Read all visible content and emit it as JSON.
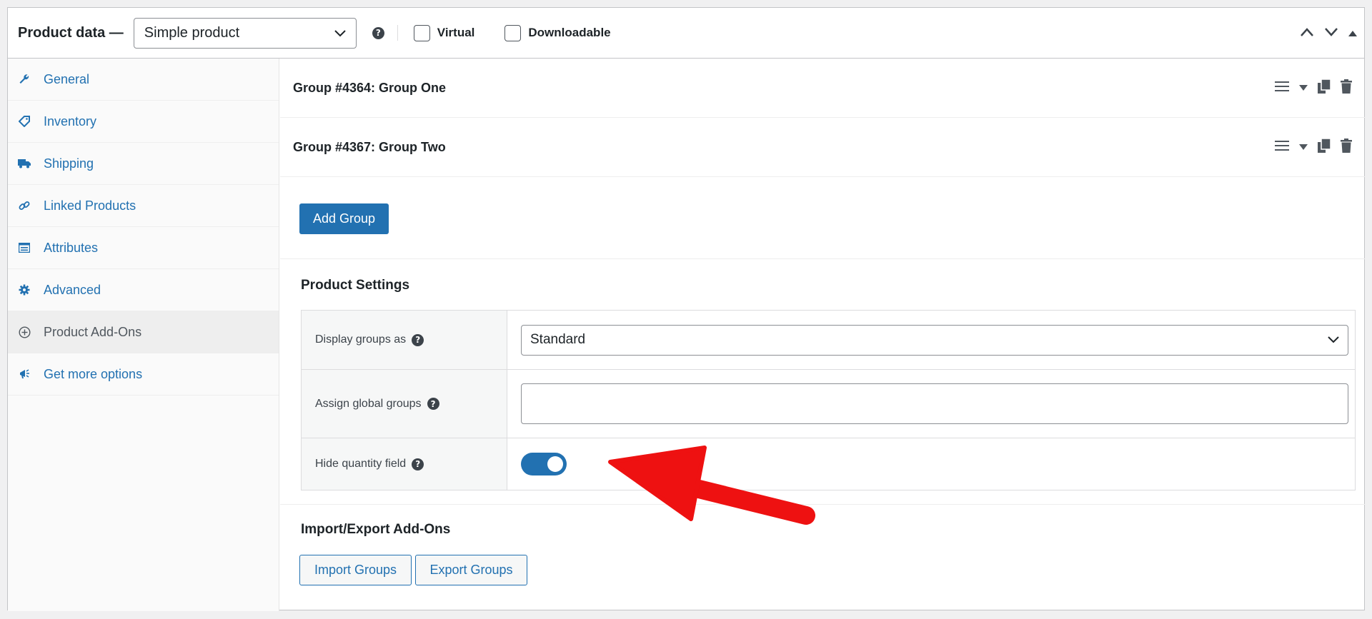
{
  "header": {
    "title": "Product data —",
    "product_type": "Simple product",
    "help": "?",
    "virtual_label": "Virtual",
    "downloadable_label": "Downloadable"
  },
  "sidebar": {
    "items": [
      {
        "label": "General",
        "icon": "wrench-icon"
      },
      {
        "label": "Inventory",
        "icon": "tag-icon"
      },
      {
        "label": "Shipping",
        "icon": "truck-icon"
      },
      {
        "label": "Linked Products",
        "icon": "link-icon"
      },
      {
        "label": "Attributes",
        "icon": "list-icon"
      },
      {
        "label": "Advanced",
        "icon": "gear-icon"
      },
      {
        "label": "Product Add-Ons",
        "icon": "plus-circle-icon"
      },
      {
        "label": "Get more options",
        "icon": "megaphone-icon"
      }
    ]
  },
  "groups": [
    {
      "title": "Group #4364: Group One"
    },
    {
      "title": "Group #4367: Group Two"
    }
  ],
  "add_group_label": "Add Group",
  "product_settings": {
    "title": "Product Settings",
    "display_groups_label": "Display groups as",
    "display_groups_value": "Standard",
    "assign_global_label": "Assign global groups",
    "hide_quantity_label": "Hide quantity field",
    "hide_quantity_on": true
  },
  "import_export": {
    "title": "Import/Export Add-Ons",
    "import_label": "Import Groups",
    "export_label": "Export Groups"
  },
  "colors": {
    "accent": "#2271b1",
    "annotation_arrow": "#ee1111"
  }
}
